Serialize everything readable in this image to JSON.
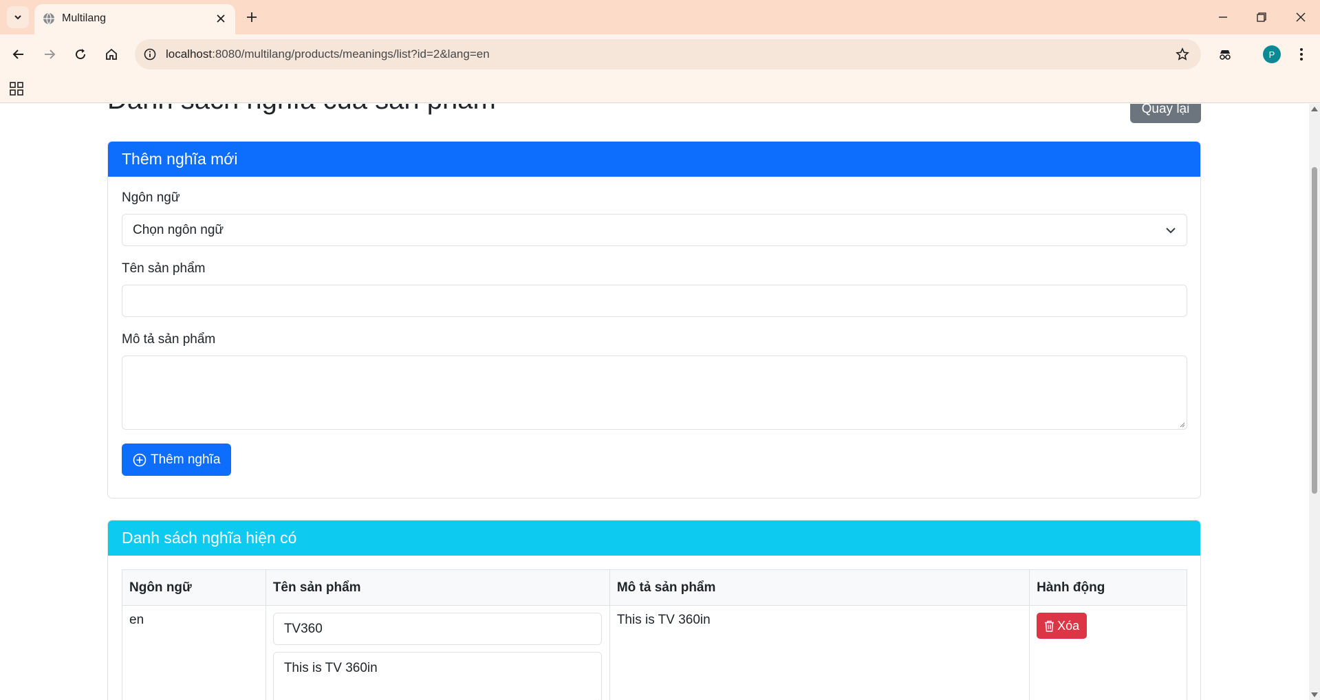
{
  "browser": {
    "tab_title": "Multilang",
    "url_host": "localhost",
    "url_rest": ":8080/multilang/products/meanings/list?id=2&lang=en",
    "profile_initial": "P"
  },
  "page": {
    "title": "Danh sách nghĩa của sản phẩm",
    "back_button": "Quay lại"
  },
  "add_card": {
    "header": "Thêm nghĩa mới",
    "language_label": "Ngôn ngữ",
    "language_selected": "Chọn ngôn ngữ",
    "name_label": "Tên sản phẩm",
    "name_value": "",
    "description_label": "Mô tả sản phẩm",
    "description_value": "",
    "submit_button": "Thêm nghĩa"
  },
  "list_card": {
    "header": "Danh sách nghĩa hiện có",
    "columns": [
      "Ngôn ngữ",
      "Tên sản phẩm",
      "Mô tả sản phẩm",
      "Hành động"
    ],
    "rows": [
      {
        "language": "en",
        "name_input": "TV360",
        "description_input": "This is TV 360in",
        "description": "This is TV 360in",
        "delete_button": "Xóa"
      }
    ]
  },
  "colors": {
    "primary": "#0d6efd",
    "info": "#0dcaf0",
    "secondary": "#6c757d",
    "danger": "#dc3545",
    "chrome_tabbar": "#fcdcc8"
  }
}
